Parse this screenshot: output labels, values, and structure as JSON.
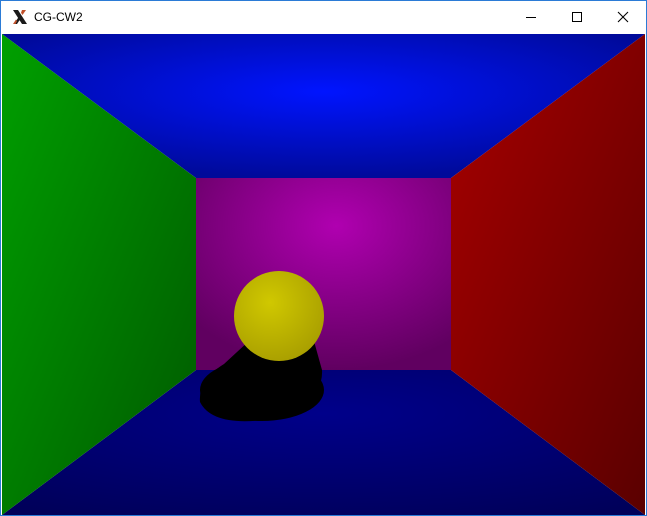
{
  "window": {
    "title": "CG-CW2",
    "controls": {
      "minimize": "minimize",
      "maximize": "maximize",
      "close": "close"
    }
  },
  "scene": {
    "colors": {
      "ceiling": "#0010f0",
      "floor": "#000090",
      "left_wall": "#00a000",
      "right_wall": "#a00000",
      "back_wall": "#a000a0",
      "sphere": "#c8c000",
      "shadow": "#000000"
    }
  },
  "icons": {
    "app": "x-app-icon",
    "minimize": "minimize-icon",
    "maximize": "maximize-icon",
    "close": "close-icon"
  }
}
